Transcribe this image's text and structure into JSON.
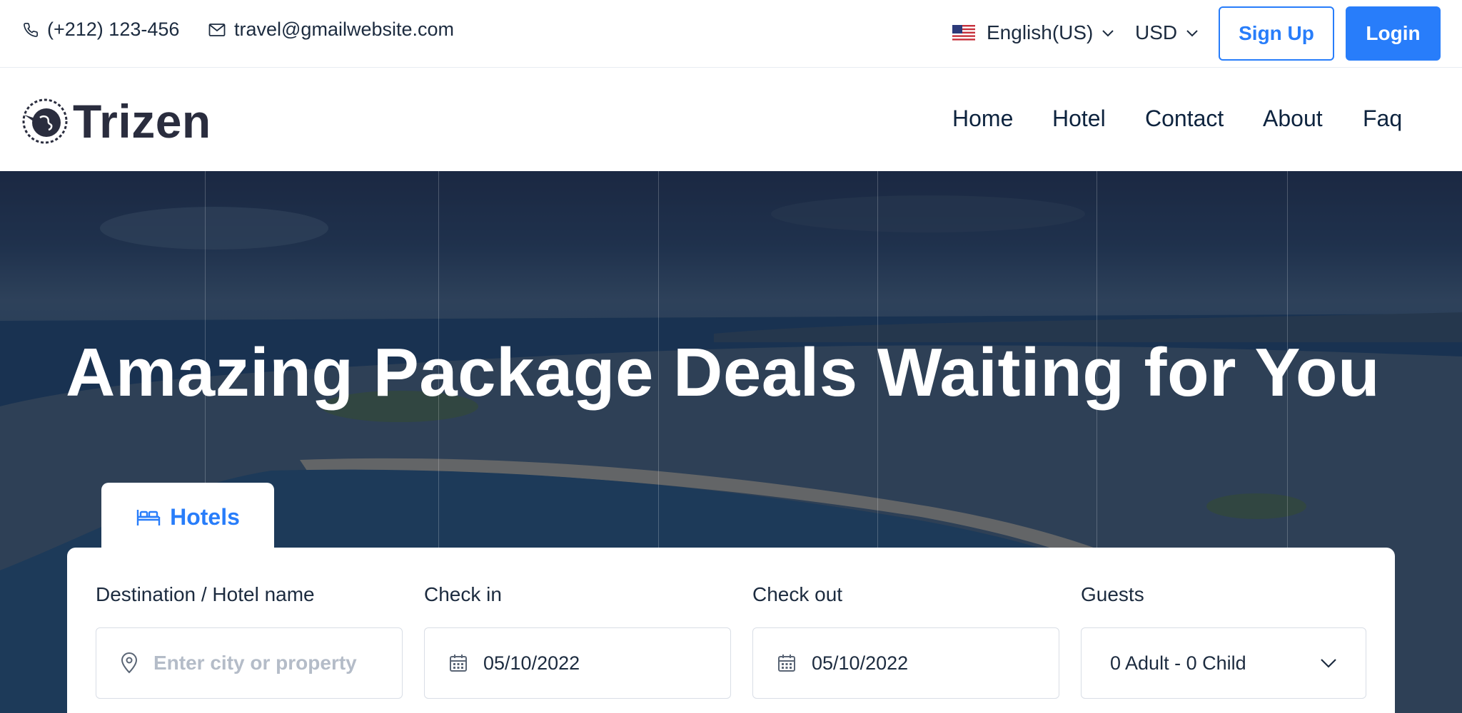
{
  "topbar": {
    "phone": "(+212) 123-456",
    "email": "travel@gmailwebsite.com",
    "language": "English(US)",
    "currency": "USD",
    "signup_label": "Sign Up",
    "login_label": "Login"
  },
  "brand": {
    "name": "Trizen"
  },
  "nav": [
    "Home",
    "Hotel",
    "Contact",
    "About",
    "Faq"
  ],
  "hero": {
    "title": "Amazing Package Deals Waiting for You"
  },
  "search": {
    "tab_label": "Hotels",
    "destination": {
      "label": "Destination / Hotel name",
      "placeholder": "Enter city or property"
    },
    "checkin": {
      "label": "Check in",
      "value": "05/10/2022"
    },
    "checkout": {
      "label": "Check out",
      "value": "05/10/2022"
    },
    "guests": {
      "label": "Guests",
      "value": "0 Adult - 0 Child"
    }
  },
  "colors": {
    "accent": "#287dfa",
    "text_dark": "#0d233e"
  }
}
